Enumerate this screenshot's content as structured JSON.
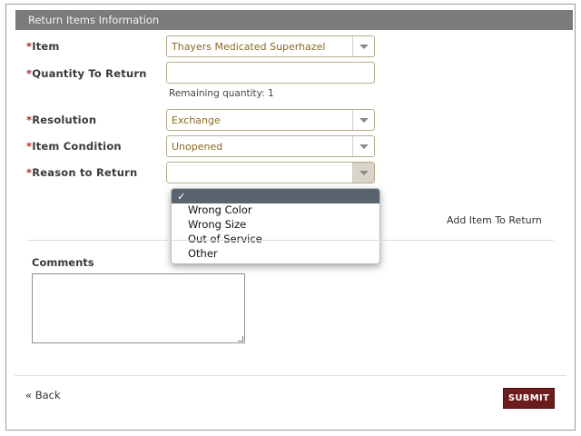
{
  "section": {
    "title": "Return Items Information"
  },
  "form": {
    "required_marker": "*",
    "item": {
      "label": "Item",
      "value": "Thayers Medicated Superhazel"
    },
    "quantity": {
      "label": "Quantity To Return",
      "value": "",
      "hint": "Remaining quantity: 1"
    },
    "resolution": {
      "label": "Resolution",
      "value": "Exchange"
    },
    "condition": {
      "label": "Item Condition",
      "value": "Unopened"
    },
    "reason": {
      "label": "Reason to Return",
      "value": "",
      "options": [
        "✓",
        "Wrong Color",
        "Wrong Size",
        "Out of Service",
        "Other"
      ]
    },
    "add_item_label": "Add Item To Return",
    "comments_label": "Comments",
    "comments_value": ""
  },
  "footer": {
    "back_label": "« Back",
    "submit_label": "SUBMIT"
  },
  "colors": {
    "header_bg": "#7b7b7b",
    "submit_bg": "#6b1c1c",
    "required": "#b03030",
    "select_text": "#8a6a20"
  }
}
